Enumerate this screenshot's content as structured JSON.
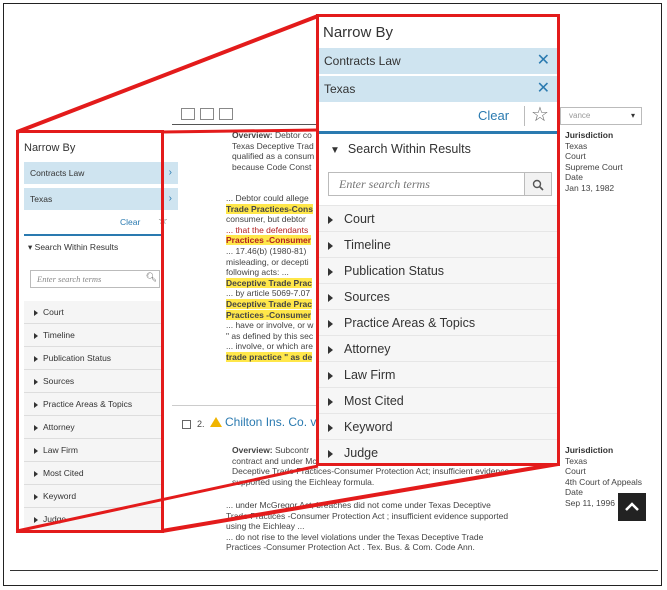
{
  "background": {
    "result1": {
      "overview_label": "Overview:",
      "overview_lines": [
        "Debtor co",
        "Texas Deceptive Trad",
        "qualified as a consum",
        "because Code Const"
      ],
      "snippets": [
        "... Debtor could allege",
        "Trade Practices-Cons",
        "consumer, but debtor",
        "... that the defendants",
        "Practices -Consumer",
        "... 17.46(b) (1980-81)",
        "misleading, or decepti",
        "following acts: ...",
        "Deceptive Trade Prac",
        "... by article 5069-7.07",
        "Deceptive Trade Prac",
        "Practices -Consumer",
        "... have or involve, or w",
        "\" as defined by this sec",
        "... involve, or which are",
        "trade practice \" as de"
      ],
      "meta": [
        "Jurisdiction",
        "Texas",
        "Court",
        "Supreme Court",
        "Date",
        "Jan 13, 1982"
      ]
    },
    "result2": {
      "number": "2.",
      "title": "Chilton Ins. Co. v.",
      "overview_label": "Overview:",
      "overview_lines": [
        "Subcontr",
        "contract and under McGregor Act; breaches did not come under Texas",
        "Deceptive Trade Practices-Consumer Protection Act; insufficient evidence",
        "supported using the Eichleay formula."
      ],
      "snippets": [
        "... under McGregor Act; breaches did not come under Texas Deceptive",
        "Trade Practices -Consumer Protection Act ; insufficient evidence supported",
        "using the Eichleay ...",
        "... do not rise to the level violations under the Texas Deceptive Trade",
        "Practices -Consumer Protection Act . Tex. Bus. & Com. Code Ann."
      ],
      "meta": [
        "Jurisdiction",
        "Texas",
        "Court",
        "4th Court of Appeals",
        "Date",
        "Sep 11, 1996"
      ]
    },
    "sort_dropdown": "vance"
  },
  "narrow_panel_small": {
    "title": "Narrow By",
    "chips": [
      {
        "label": "Contracts Law"
      },
      {
        "label": "Texas"
      }
    ],
    "clear_label": "Clear",
    "search_header": "Search Within Results",
    "search_placeholder": "Enter search terms",
    "filters": [
      "Court",
      "Timeline",
      "Publication Status",
      "Sources",
      "Practice Areas & Topics",
      "Attorney",
      "Law Firm",
      "Most Cited",
      "Keyword",
      "Judge"
    ]
  },
  "narrow_panel_zoom": {
    "title": "Narrow By",
    "chips": [
      {
        "label": "Contracts Law"
      },
      {
        "label": "Texas"
      }
    ],
    "clear_label": "Clear",
    "search_header": "Search Within Results",
    "search_placeholder": "Enter search terms",
    "filters": [
      "Court",
      "Timeline",
      "Publication Status",
      "Sources",
      "Practice Areas & Topics",
      "Attorney",
      "Law Firm",
      "Most Cited",
      "Keyword",
      "Judge"
    ]
  },
  "colors": {
    "highlight": "#e31b1b",
    "accent": "#2a7ab0",
    "chip": "#cfe4f0"
  }
}
